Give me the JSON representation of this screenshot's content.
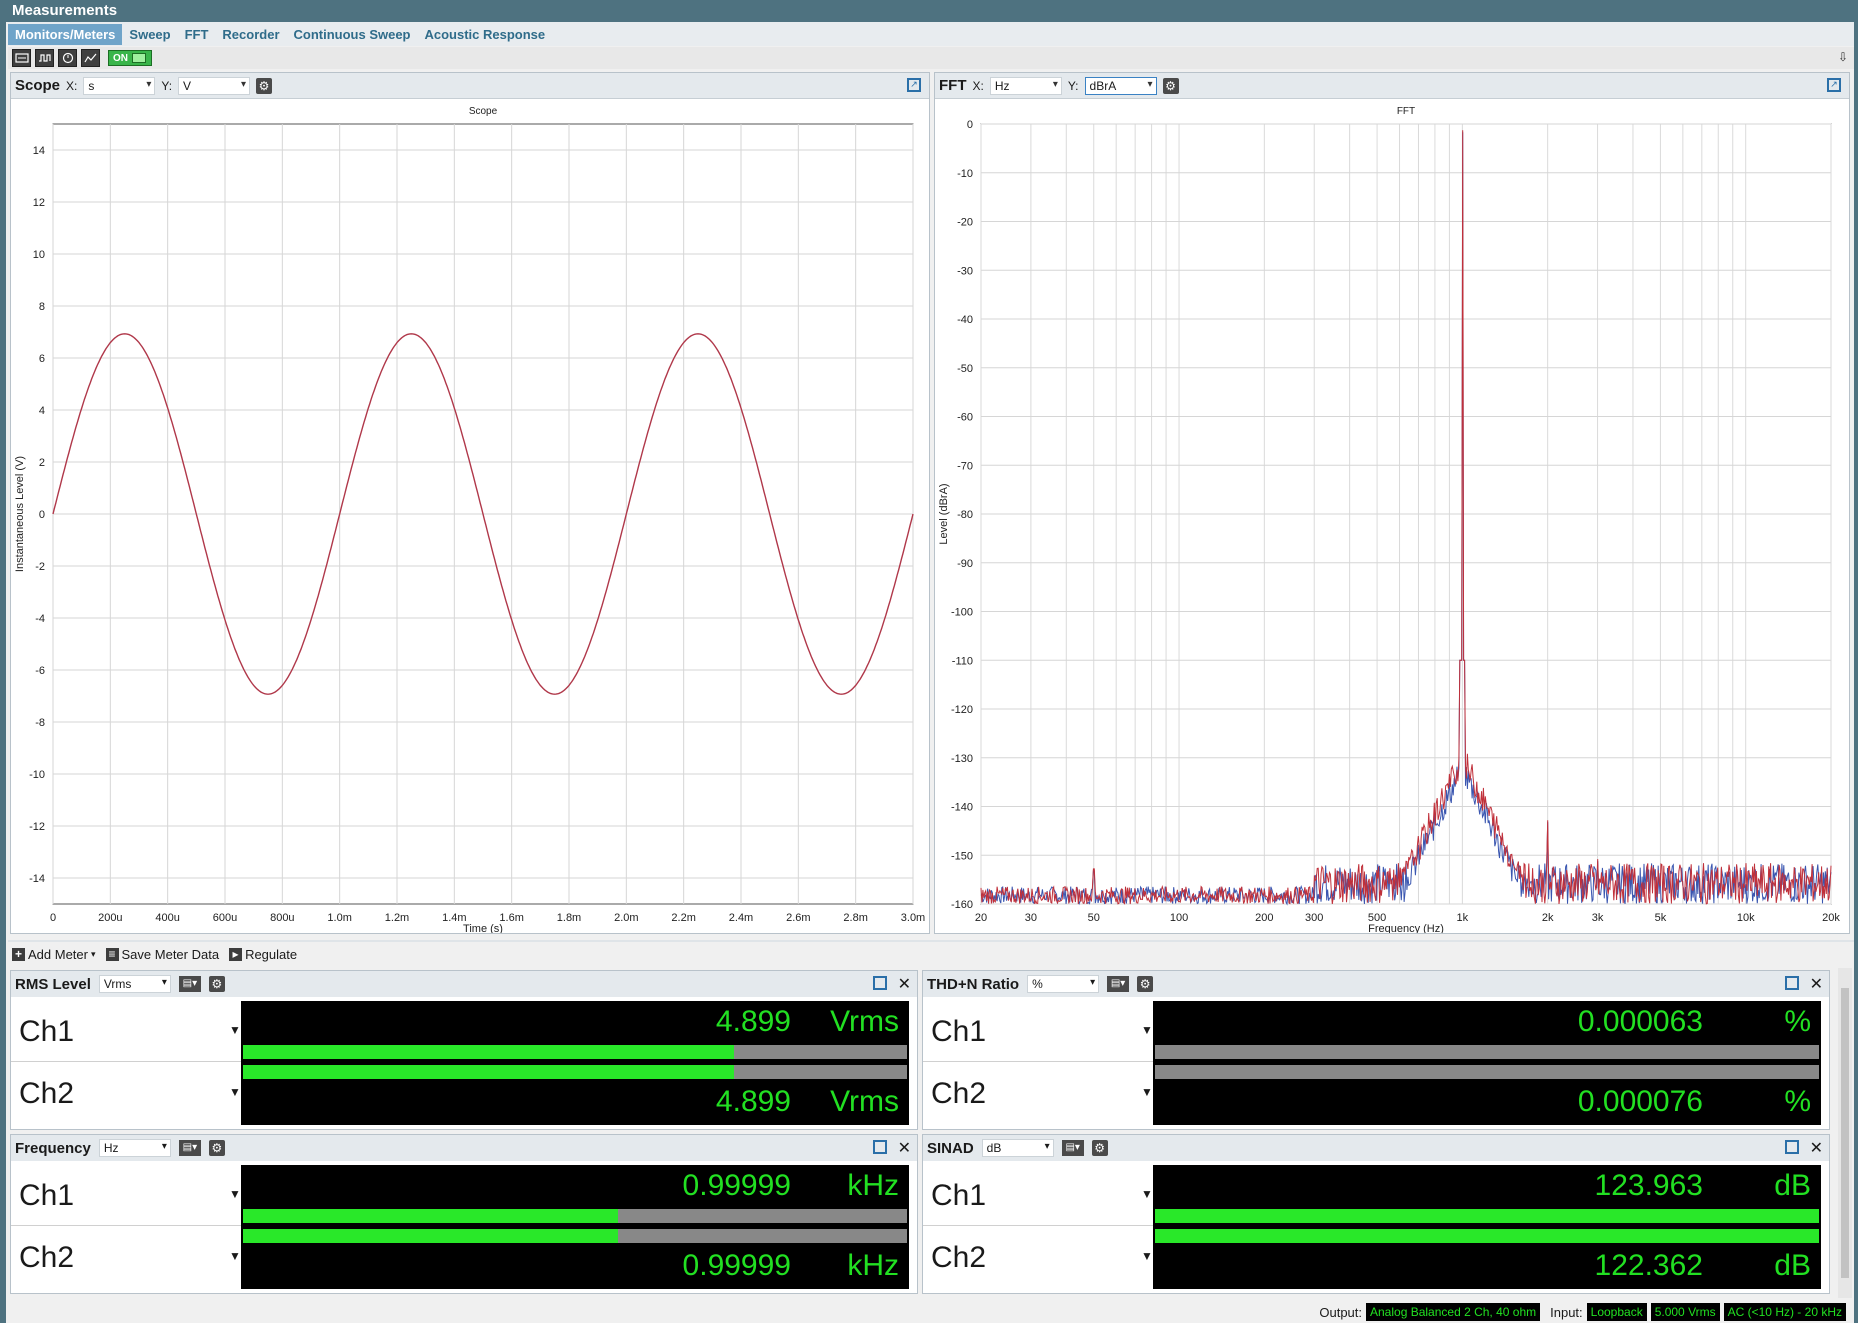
{
  "title": "Measurements",
  "tabs": [
    "Monitors/Meters",
    "Sweep",
    "FFT",
    "Recorder",
    "Continuous Sweep",
    "Acoustic Response"
  ],
  "toolbar": {
    "on_label": "ON"
  },
  "scope": {
    "title": "Scope",
    "x_label": "X:",
    "x_unit": "s",
    "y_label": "Y:",
    "y_unit": "V",
    "chart_data": {
      "type": "line",
      "title": "Scope",
      "xlabel": "Time (s)",
      "ylabel": "Instantaneous Level (V)",
      "xlim": [
        0,
        0.003
      ],
      "ylim": [
        -15,
        15
      ],
      "x_ticks": [
        "0",
        "200u",
        "400u",
        "600u",
        "800u",
        "1.0m",
        "1.2m",
        "1.4m",
        "1.6m",
        "1.8m",
        "2.0m",
        "2.2m",
        "2.4m",
        "2.6m",
        "2.8m",
        "3.0m"
      ],
      "y_ticks": [
        "14",
        "12",
        "10",
        "8",
        "6",
        "4",
        "2",
        "0",
        "-2",
        "-4",
        "-6",
        "-8",
        "-10",
        "-12",
        "-14"
      ],
      "series": [
        {
          "amplitude": 6.93,
          "frequency": 1000,
          "color": "#b0384a"
        }
      ]
    }
  },
  "fft": {
    "title": "FFT",
    "x_label": "X:",
    "x_unit": "Hz",
    "y_label": "Y:",
    "y_unit": "dBrA",
    "chart_data": {
      "type": "line",
      "title": "FFT",
      "xlabel": "Frequency (Hz)",
      "ylabel": "Level (dBrA)",
      "xscale": "log",
      "xlim": [
        20,
        20000
      ],
      "ylim": [
        -160,
        0
      ],
      "x_ticks": [
        "20",
        "30",
        "50",
        "100",
        "200",
        "300",
        "500",
        "1k",
        "2k",
        "3k",
        "5k",
        "10k",
        "20k"
      ],
      "y_ticks": [
        "0",
        "-10",
        "-20",
        "-30",
        "-40",
        "-50",
        "-60",
        "-70",
        "-80",
        "-90",
        "-100",
        "-110",
        "-120",
        "-130",
        "-140",
        "-150",
        "-160"
      ],
      "peaks": [
        {
          "freq": 1000,
          "level": -1.5
        },
        {
          "freq": 2000,
          "level": -143
        },
        {
          "freq": 3000,
          "level": -151
        },
        {
          "freq": 50,
          "level": -153
        }
      ],
      "series_colors": [
        "#3a56b0",
        "#c0303a"
      ]
    }
  },
  "meter_toolbar": {
    "add": "Add Meter",
    "save": "Save Meter Data",
    "regulate": "Regulate"
  },
  "meters": {
    "rms": {
      "title": "RMS Level",
      "unit_sel": "Vrms",
      "ch1": "4.899",
      "ch2": "4.899",
      "unit": "Vrms",
      "fill1": 0.74,
      "fill2": 0.74
    },
    "thdn": {
      "title": "THD+N Ratio",
      "unit_sel": "%",
      "ch1": "0.000063",
      "ch2": "0.000076",
      "unit": "%",
      "fill1": 0.0,
      "fill2": 0.0
    },
    "freq": {
      "title": "Frequency",
      "unit_sel": "Hz",
      "ch1": "0.99999",
      "ch2": "0.99999",
      "unit": "kHz",
      "fill1": 0.565,
      "fill2": 0.565
    },
    "sinad": {
      "title": "SINAD",
      "unit_sel": "dB",
      "ch1": "123.963",
      "ch2": "122.362",
      "unit": "dB",
      "fill1": 1.0,
      "fill2": 1.0
    }
  },
  "channels": {
    "ch1": "Ch1",
    "ch2": "Ch2"
  },
  "status": {
    "output_label": "Output:",
    "output_value": "Analog Balanced 2 Ch, 40 ohm",
    "input_label": "Input:",
    "input_value": "Loopback",
    "input_level": "5.000 Vrms",
    "input_filter": "AC (<10 Hz) - 20 kHz"
  }
}
